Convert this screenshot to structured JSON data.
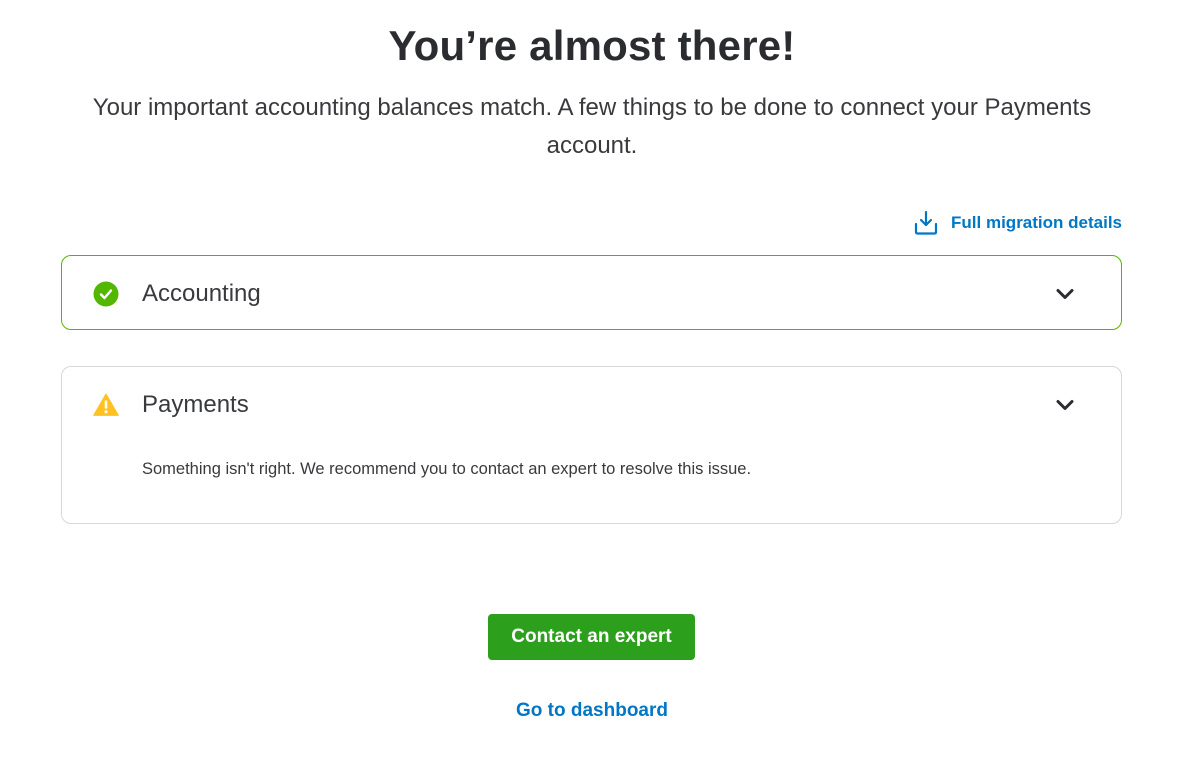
{
  "header": {
    "title": "You’re almost there!",
    "subtitle": "Your important accounting balances match. A few things to be done to connect your Payments account."
  },
  "migration_link": {
    "icon": "download-icon",
    "label": "Full migration details"
  },
  "sections": [
    {
      "label": "Accounting",
      "status": "success",
      "status_icon": "check-circle-icon",
      "status_color": "#53b700",
      "expand_icon": "chevron-down-icon"
    },
    {
      "label": "Payments",
      "status": "warning",
      "status_icon": "warning-triangle-icon",
      "status_color": "#ffc220",
      "expand_icon": "chevron-down-icon",
      "message": "Something isn't right. We recommend you to contact an expert to resolve this issue."
    }
  ],
  "actions": {
    "primary_label": "Contact an expert",
    "secondary_label": "Go to dashboard"
  },
  "colors": {
    "accent_green": "#2ca01c",
    "link_blue": "#0077c5",
    "success_border": "#53b700",
    "neutral_border": "#d4d7dc"
  }
}
